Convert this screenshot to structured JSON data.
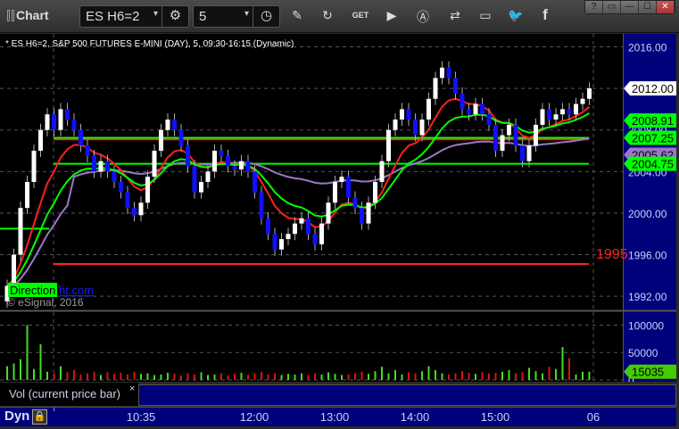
{
  "toolbar": {
    "title": "Chart",
    "symbol": "ES H6=2",
    "interval": "5",
    "icons": [
      "settings-icon",
      "clock-icon",
      "pencil-icon",
      "refresh-icon",
      "get-icon",
      "play-icon",
      "alert-icon",
      "link-icon",
      "comment-icon",
      "twitter-icon",
      "facebook-icon"
    ],
    "window_buttons": [
      "?",
      "▭",
      "—",
      "☐",
      "✕"
    ]
  },
  "chart": {
    "header": "* ES H6=2, S&P 500 FUTURES E-MINI (DAY), 5, 09:30-16:15 (Dynamic)",
    "price_ticks": [
      "2016.00",
      "2012.00",
      "2008.00",
      "2004.00",
      "2000.00",
      "1996.00",
      "1992.00"
    ],
    "price_tick_values": [
      2016,
      2012,
      2008,
      2004,
      2000,
      1996,
      1992
    ],
    "price_range": [
      1991.5,
      2016.9
    ],
    "last_price": "2012.00",
    "markers": [
      {
        "label": "2008.91",
        "value": 2008.91,
        "color": "#00ff00"
      },
      {
        "label": "2007.25",
        "value": 2007.25,
        "color": "#00ff00"
      },
      {
        "label": "2005.62",
        "value": 2005.62,
        "color": "#9a78c8"
      },
      {
        "label": "2004.75",
        "value": 2004.75,
        "color": "#00ff00"
      }
    ],
    "levels": [
      {
        "value": 2007.1,
        "color": "#ff2020"
      },
      {
        "value": 2007.25,
        "color": "#00ff00"
      },
      {
        "value": 2004.75,
        "color": "#00ff00"
      },
      {
        "value": 1995.1,
        "color": "#ff2020"
      }
    ],
    "level_label": "1995",
    "direction_label": "Direction",
    "link_text": "ht.com",
    "copyright": "© eSignal, 2016",
    "closes": [
      1993,
      1996,
      2000.5,
      2003,
      2006,
      2008,
      2009.5,
      2008,
      2010,
      2009,
      2008,
      2006.5,
      2005.5,
      2004,
      2005,
      2004,
      2003,
      2002,
      2000.5,
      1999.8,
      2001,
      2003.5,
      2006,
      2008,
      2009,
      2008,
      2006.5,
      2004.5,
      2002,
      2003,
      2004,
      2006,
      2005.5,
      2004.5,
      2004.2,
      2005,
      2004,
      2002,
      1999.5,
      1998,
      1996.5,
      1997.5,
      1998,
      1999,
      1999.5,
      1998,
      1997,
      1999,
      2001,
      2003,
      2003.5,
      2001.5,
      2000.5,
      1999,
      2001,
      2003,
      2005,
      2008,
      2009,
      2010,
      2009,
      2007.5,
      2009,
      2011,
      2013,
      2014,
      2013,
      2011.5,
      2010,
      2009.5,
      2010.5,
      2009.5,
      2008.5,
      2006,
      2007.5,
      2008.5,
      2006.5,
      2005,
      2006.5,
      2008.5,
      2010,
      2009,
      2009.5,
      2010,
      2009.5,
      2010.5,
      2011,
      2012
    ],
    "volumes": [
      25000,
      30000,
      38000,
      100000,
      20000,
      65000,
      15000,
      12000,
      25000,
      14000,
      18000,
      10000,
      12000,
      15000,
      9000,
      14000,
      11000,
      13000,
      10000,
      15000,
      11000,
      12000,
      9000,
      10000,
      13000,
      12000,
      8000,
      12000,
      10000,
      14000,
      9000,
      10000,
      12000,
      8000,
      11000,
      13000,
      9000,
      12000,
      15000,
      10000,
      12000,
      9000,
      11000,
      10000,
      12000,
      9000,
      12000,
      10000,
      14000,
      11000,
      9000,
      10000,
      12000,
      15000,
      11000,
      16000,
      24000,
      12000,
      18000,
      10000,
      14000,
      12000,
      16000,
      25000,
      18000,
      12000,
      10000,
      12000,
      16000,
      13000,
      11000,
      14000,
      12000,
      13000,
      15000,
      18000,
      12000,
      14000,
      22000,
      16000,
      12000,
      24000,
      20000,
      60000,
      40000,
      10000,
      15000,
      15035
    ],
    "vol_ticks": [
      "100000",
      "50000",
      "0"
    ],
    "vol_tick_values": [
      100000,
      50000,
      0
    ],
    "vol_range": [
      0,
      117000
    ],
    "vol_last": "15035",
    "vol_label": "Vol (current price bar)",
    "close_symbol": "×"
  },
  "time_axis": {
    "mode": "Dyn",
    "labels": [
      "10:35",
      "12:00",
      "13:00",
      "14:00",
      "15:00",
      "06"
    ]
  },
  "colors": {
    "up": "#ffffff",
    "down": "#1010ff",
    "axis_bg": "#00007a",
    "ema_fast": "#00ff00",
    "ema_slow": "#ff2020",
    "avg": "#9a78c8"
  }
}
